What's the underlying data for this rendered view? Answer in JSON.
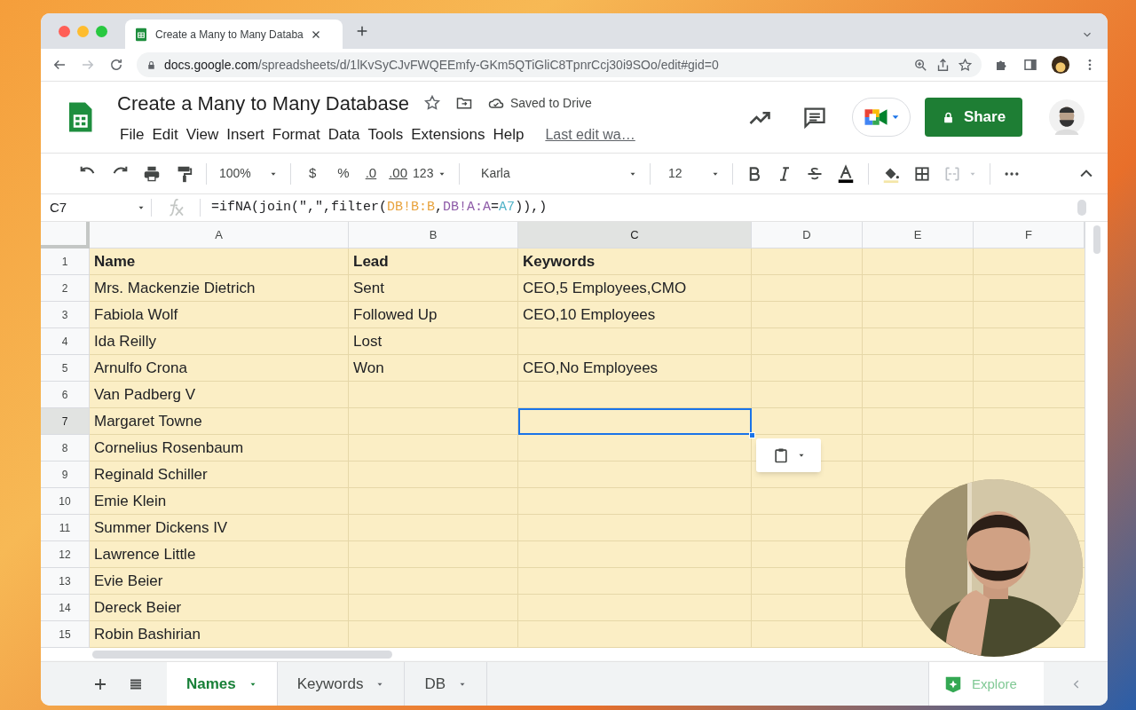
{
  "browser": {
    "tab_title": "Create a Many to Many Databa",
    "url_host": "docs.google.com",
    "url_path": "/spreadsheets/d/1lKvSyCJvFWQEEmfy-GKm5QTiGliC8TpnrCcj30i9SOo/edit#gid=0"
  },
  "doc": {
    "title": "Create a Many to Many Database",
    "saved": "Saved to Drive",
    "last_edit": "Last edit wa…",
    "share": "Share"
  },
  "menu": [
    "File",
    "Edit",
    "View",
    "Insert",
    "Format",
    "Data",
    "Tools",
    "Extensions",
    "Help"
  ],
  "toolbar": {
    "zoom": "100%",
    "currency": "$",
    "percent": "%",
    "decrease_decimals": ".0",
    "increase_decimals": ".00",
    "number_format": "123",
    "font": "Karla",
    "font_size": "12"
  },
  "formula_bar": {
    "cell": "C7",
    "parts": [
      {
        "text": "=ifNA(join(\",\",filter(",
        "color": "#202124"
      },
      {
        "text": "DB!B:B",
        "color": "#e8a33d"
      },
      {
        "text": ",",
        "color": "#202124"
      },
      {
        "text": "DB!A:A",
        "color": "#8e5ba8"
      },
      {
        "text": "=",
        "color": "#202124"
      },
      {
        "text": "A7",
        "color": "#4fb3c8"
      },
      {
        "text": ")),)",
        "color": "#202124"
      }
    ]
  },
  "columns": [
    {
      "label": "A",
      "selected": false
    },
    {
      "label": "B",
      "selected": false
    },
    {
      "label": "C",
      "selected": true
    },
    {
      "label": "D",
      "selected": false
    },
    {
      "label": "E",
      "selected": false
    },
    {
      "label": "F",
      "selected": false
    }
  ],
  "rows": [
    {
      "number": "1",
      "selected": false,
      "cells": [
        "Name",
        "Lead",
        "Keywords"
      ]
    },
    {
      "number": "2",
      "selected": false,
      "cells": [
        "Mrs. Mackenzie Dietrich",
        "Sent",
        "CEO,5 Employees,CMO"
      ]
    },
    {
      "number": "3",
      "selected": false,
      "cells": [
        "Fabiola Wolf",
        "Followed Up",
        "CEO,10 Employees"
      ]
    },
    {
      "number": "4",
      "selected": false,
      "cells": [
        "Ida Reilly",
        "Lost",
        ""
      ]
    },
    {
      "number": "5",
      "selected": false,
      "cells": [
        "Arnulfo Crona",
        "Won",
        "CEO,No Employees"
      ]
    },
    {
      "number": "6",
      "selected": false,
      "cells": [
        "Van Padberg V",
        "",
        ""
      ]
    },
    {
      "number": "7",
      "selected": true,
      "cells": [
        "Margaret Towne",
        "",
        ""
      ]
    },
    {
      "number": "8",
      "selected": false,
      "cells": [
        "Cornelius Rosenbaum",
        "",
        ""
      ]
    },
    {
      "number": "9",
      "selected": false,
      "cells": [
        "Reginald Schiller",
        "",
        ""
      ]
    },
    {
      "number": "10",
      "selected": false,
      "cells": [
        "Emie Klein",
        "",
        ""
      ]
    },
    {
      "number": "11",
      "selected": false,
      "cells": [
        "Summer Dickens IV",
        "",
        ""
      ]
    },
    {
      "number": "12",
      "selected": false,
      "cells": [
        "Lawrence Little",
        "",
        ""
      ]
    },
    {
      "number": "13",
      "selected": false,
      "cells": [
        "Evie Beier",
        "",
        ""
      ]
    },
    {
      "number": "14",
      "selected": false,
      "cells": [
        "Dereck Beier",
        "",
        ""
      ]
    },
    {
      "number": "15",
      "selected": false,
      "cells": [
        "Robin Bashirian",
        "",
        ""
      ]
    }
  ],
  "sheet_tabs": [
    {
      "label": "Names",
      "selected": true
    },
    {
      "label": "Keywords",
      "selected": false
    },
    {
      "label": "DB",
      "selected": false
    }
  ],
  "explore": "Explore"
}
